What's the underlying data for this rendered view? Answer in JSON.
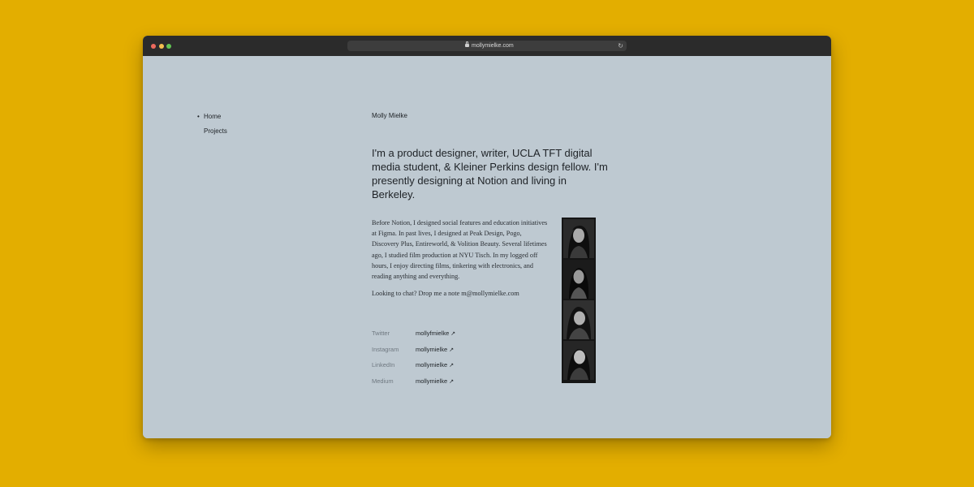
{
  "browser": {
    "url": "mollymielke.com",
    "lock_icon": "lock-icon",
    "reload_icon": "reload-icon",
    "reload_glyph": "↻"
  },
  "nav": {
    "bullet": "•",
    "items": [
      {
        "label": "Home",
        "active": true
      },
      {
        "label": "Projects",
        "active": false
      }
    ]
  },
  "header": {
    "name": "Molly Mielke"
  },
  "intro": "I'm a product designer, writer, UCLA TFT digital media student, & Kleiner Perkins design fellow. I'm presently designing at Notion and living in Berkeley.",
  "bio": {
    "paragraph1": "Before Notion, I designed social features and education initiatives at Figma. In past lives, I designed at Peak Design, Pogo, Discovery Plus, Entireworld, & Volition Beauty. Several lifetimes ago, I studied film production at NYU Tisch. In my logged off hours, I enjoy directing films, tinkering with electronics, and reading anything and everything.",
    "paragraph2": "Looking to chat? Drop me a note m@mollymielke.com"
  },
  "social": {
    "arrow": "↗",
    "items": [
      {
        "platform": "Twitter",
        "handle": "mollyfmielke"
      },
      {
        "platform": "Instagram",
        "handle": "mollymielke"
      },
      {
        "platform": "LinkedIn",
        "handle": "mollymielke"
      },
      {
        "platform": "Medium",
        "handle": "mollymielke"
      }
    ]
  },
  "colors": {
    "background": "#E3AE00",
    "page": "#BEC9D1",
    "titlebar": "#2B2B2B",
    "text": "#1E2226",
    "muted": "#6F7880"
  }
}
